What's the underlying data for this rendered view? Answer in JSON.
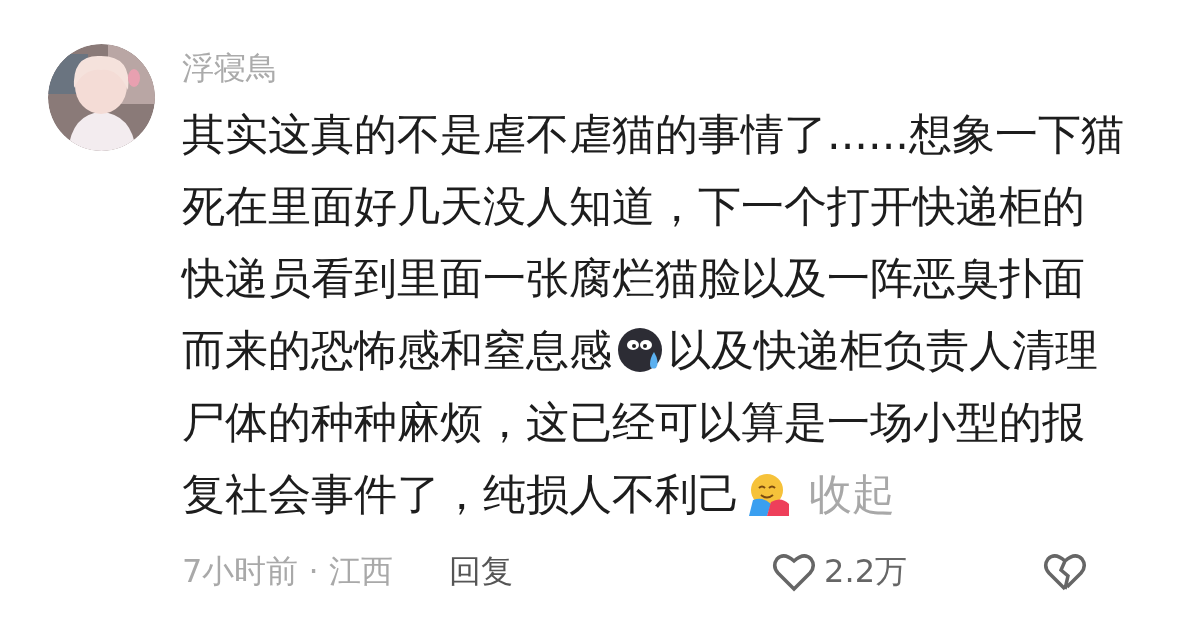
{
  "comment": {
    "author": "浮寝鳥",
    "lines": [
      [
        {
          "kind": "text",
          "text": "其实这真的不是虐不虐猫的事情了......想象一下猫"
        }
      ],
      [
        {
          "kind": "text",
          "text": "死在里面好几天没人知道，下一个打开快递柜的"
        }
      ],
      [
        {
          "kind": "text",
          "text": "快递员看到里面一张腐烂猫脸以及一阵恶臭扑面"
        }
      ],
      [
        {
          "kind": "text",
          "text": "而来的恐怖感和窒息感"
        },
        {
          "kind": "sweat"
        },
        {
          "kind": "text",
          "text": "以及快递柜负责人清理"
        }
      ],
      [
        {
          "kind": "text",
          "text": "尸体的种种麻烦，这已经可以算是一场小型的报"
        }
      ],
      [
        {
          "kind": "text",
          "text": "复社会事件了，纯损人不利己"
        },
        {
          "kind": "hug"
        }
      ]
    ],
    "collapse": "收起",
    "meta": "7小时前 · 江西",
    "reply": "回复",
    "likes": "2.2万"
  }
}
